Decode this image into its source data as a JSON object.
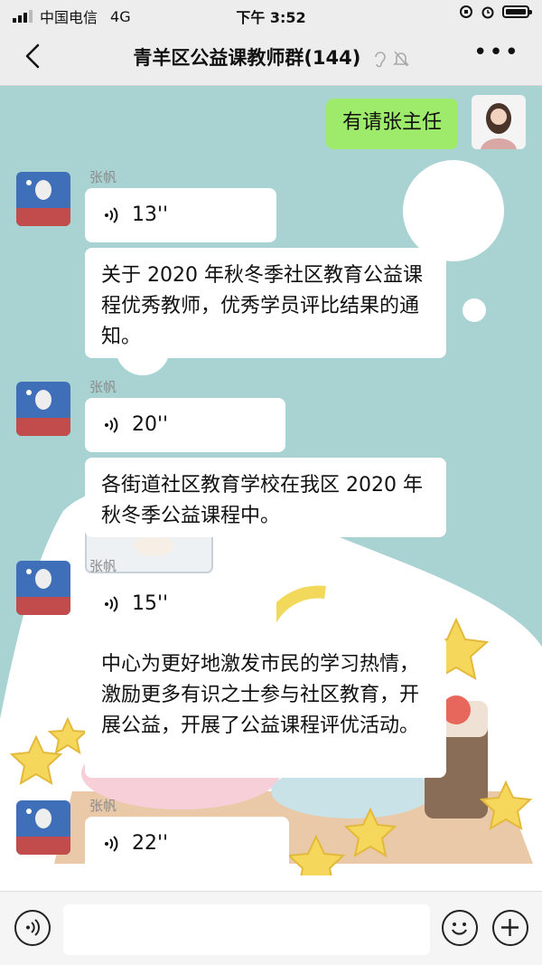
{
  "status_bar": {
    "carrier": "中国电信",
    "network": "4G",
    "time": "下午 3:52"
  },
  "nav": {
    "title": "青羊区公益课教师群(144)"
  },
  "messages": [
    {
      "from": "me",
      "text": "有请张主任"
    },
    {
      "sender": "张帆",
      "voice_duration": "13''",
      "text": "关于 2020 年秋冬季社区教育公益课程优秀教师，优秀学员评比结果的通知。"
    },
    {
      "sender": "张帆",
      "voice_duration": "20''",
      "text": "各街道社区教育学校在我区 2020 年秋冬季公益课程中。"
    },
    {
      "sender": "张帆",
      "voice_duration": "15''",
      "text": "中心为更好地激发市民的学习热情，激励更多有识之士参与社区教育，开展公益，开展了公益课程评优活动。"
    },
    {
      "sender": "张帆",
      "voice_duration": "22''"
    }
  ],
  "colors": {
    "chat_bg": "#a9d3d3",
    "my_bubble": "#9eea6a",
    "other_bubble": "#ffffff"
  }
}
